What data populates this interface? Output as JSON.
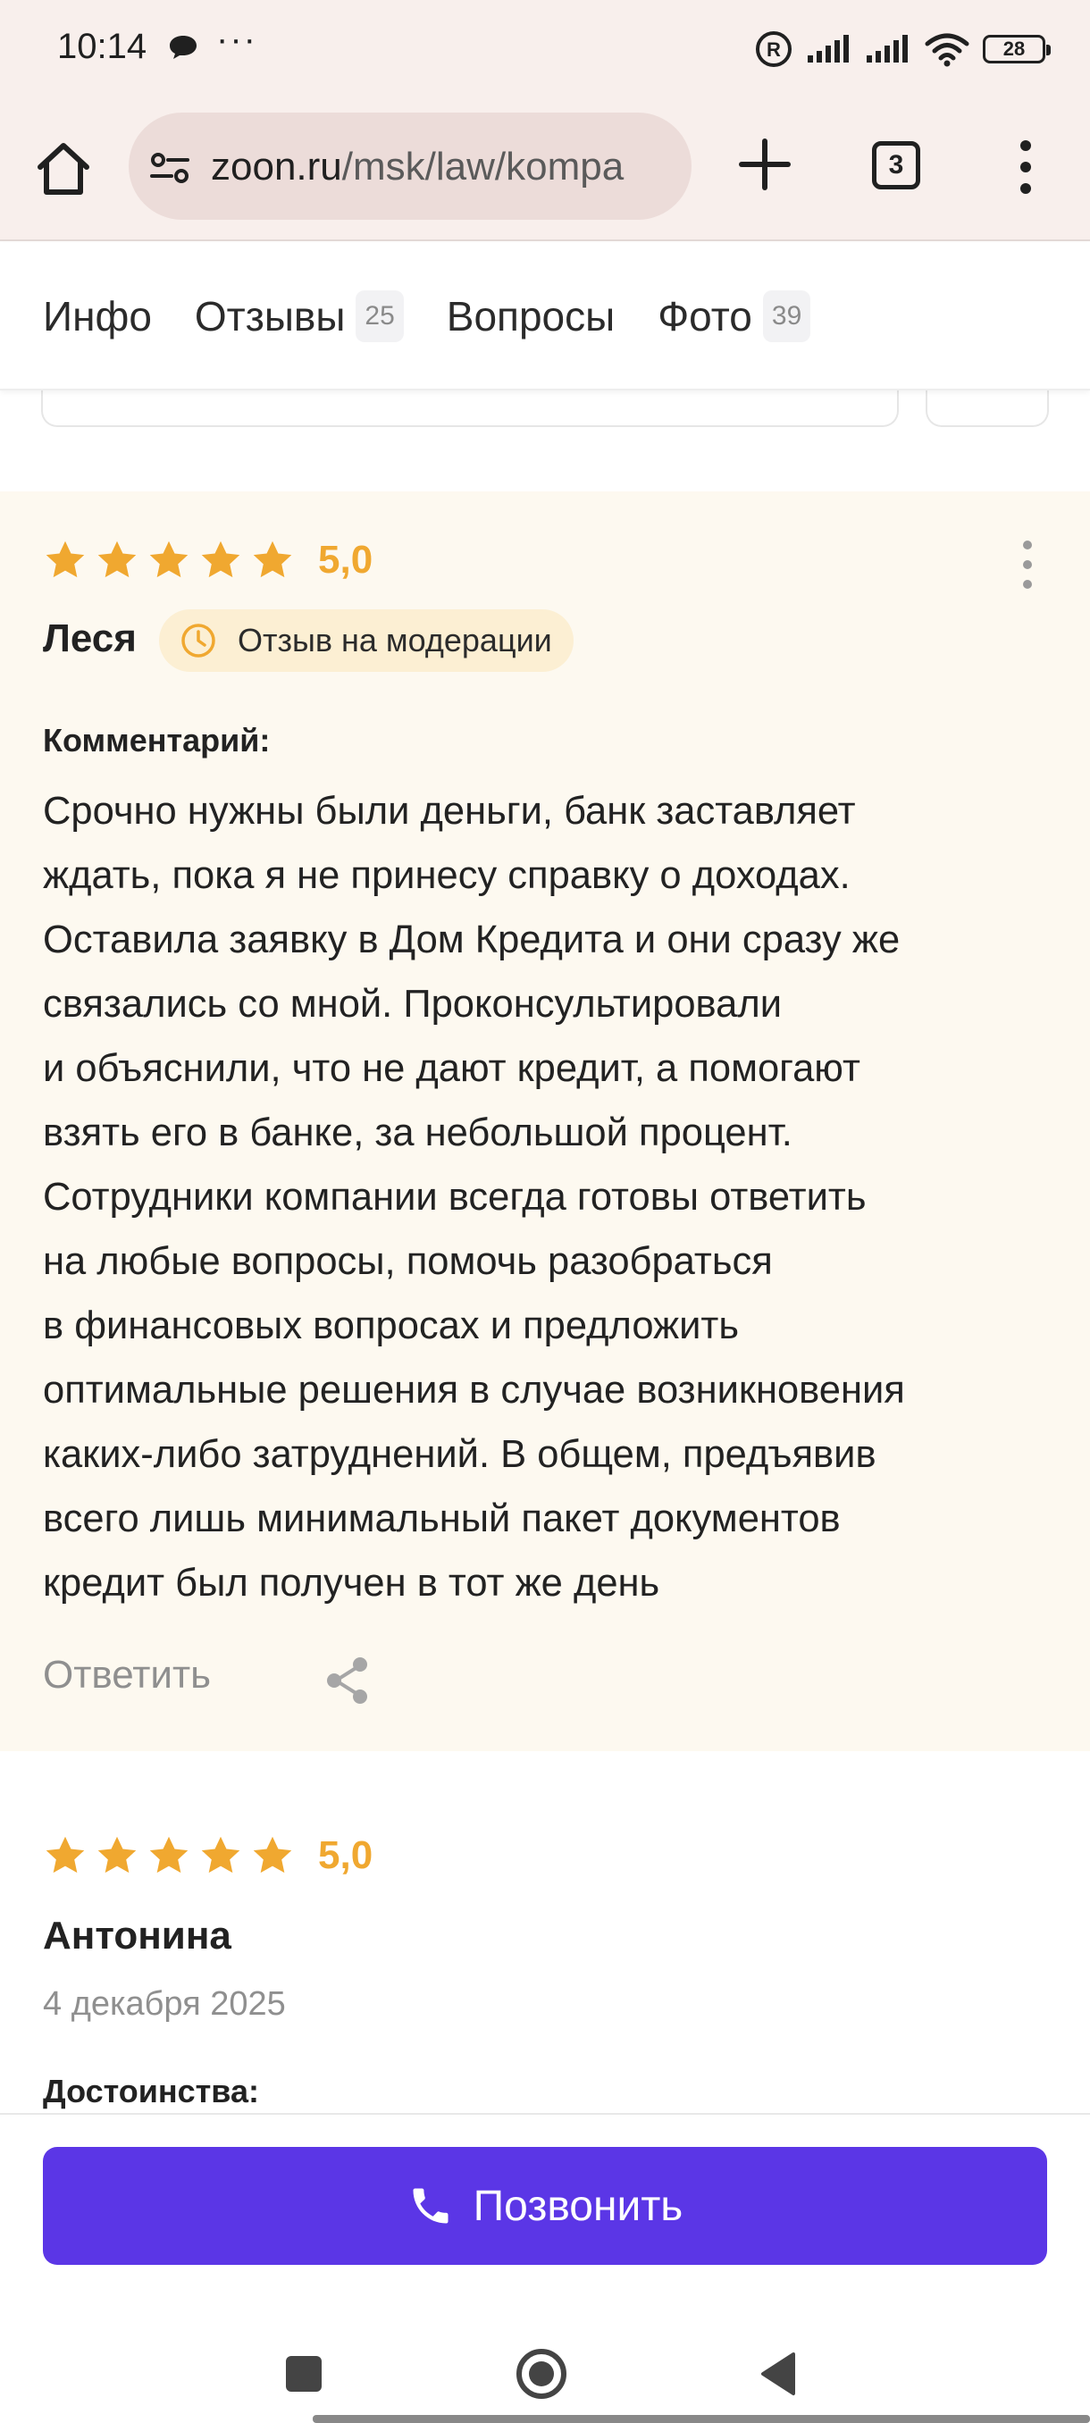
{
  "status_bar": {
    "time": "10:14",
    "dots": "···",
    "battery": "28",
    "icons": [
      "chat-bubble-icon",
      "registered-icon",
      "signal-icon",
      "signal-icon",
      "wifi-icon",
      "battery-icon"
    ]
  },
  "browser": {
    "url_host": "zoon.ru",
    "url_path": "/msk/law/kompa",
    "tab_count": "3",
    "icons": [
      "home-icon",
      "page-info-icon",
      "plus-icon",
      "more-vert-icon"
    ]
  },
  "tabs": [
    {
      "label": "Инфо",
      "count": ""
    },
    {
      "label": "Отзывы",
      "count": "25"
    },
    {
      "label": "Вопросы",
      "count": ""
    },
    {
      "label": "Фото",
      "count": "39"
    }
  ],
  "review1": {
    "rating": "5,0",
    "author": "Леся",
    "badge": "Отзыв на модерации",
    "comment_label": "Комментарий:",
    "lines": [
      "Срочно нужны были деньги, банк заставляет",
      "ждать, пока я не принесу справку о доходах.",
      "Оставила заявку в Дом Кредита и они сразу же",
      "связались со мной. Проконсультировали",
      "и объяснили, что не дают кредит, а помогают",
      "взять его в банке, за небольшой процент.",
      "Сотрудники компании всегда готовы ответить",
      "на любые вопросы, помочь разобраться",
      "в финансовых вопросах и предложить",
      "оптимальные решения в случае возникновения",
      "каких-либо затруднений. В общем, предъявив",
      "всего лишь минимальный пакет документов",
      "кредит был получен в тот же день"
    ],
    "reply_label": "Ответить"
  },
  "review2": {
    "rating": "5,0",
    "author": "Антонина",
    "date": "4 декабря 2025",
    "section_label": "Достоинства:"
  },
  "call": {
    "label": "Позвонить"
  },
  "colors": {
    "star": "#f0a830",
    "call_button": "#5b36e6",
    "review_highlight": "#fdf9f0",
    "badge": "#fcefd3"
  }
}
